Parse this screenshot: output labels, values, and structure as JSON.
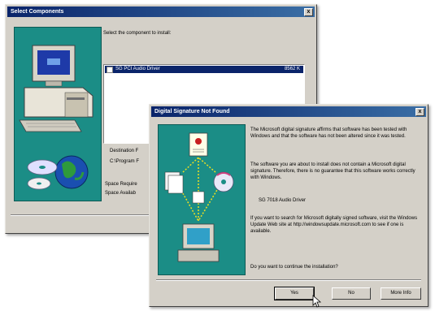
{
  "select_window": {
    "title": "Select Components",
    "close_glyph": "x",
    "instruction": "Select the component to install:",
    "list_items": [
      {
        "label": "SG PCI Audio Driver",
        "size": "8562 K"
      }
    ],
    "destination_label": "Destination F",
    "destination_path": "C:\\Program F",
    "space_required": "Space Require",
    "space_available": "Space Availab"
  },
  "signature_dialog": {
    "title": "Digital Signature Not Found",
    "close_glyph": "x",
    "para1": "The Microsoft digital signature affirms that software has been tested with Windows and that the software has not been altered since it was tested.",
    "para2": "The software you are about to install does not contain a Microsoft digital signature. Therefore, there is no guarantee that this software works correctly with Windows.",
    "driver_name": "SG 7018 Audio Driver",
    "para3": "If you want to search for Microsoft digitally signed software, visit the Windows Update Web site at http://windowsupdate.microsoft.com to see if one is available.",
    "question": "Do you want to continue the installation?",
    "buttons": {
      "yes": "Yes",
      "no": "No",
      "more_info": "More Info"
    }
  },
  "colors": {
    "title_bar": "#0a246a",
    "teal_panel": "#1b8d86",
    "face": "#d4d0c8"
  }
}
